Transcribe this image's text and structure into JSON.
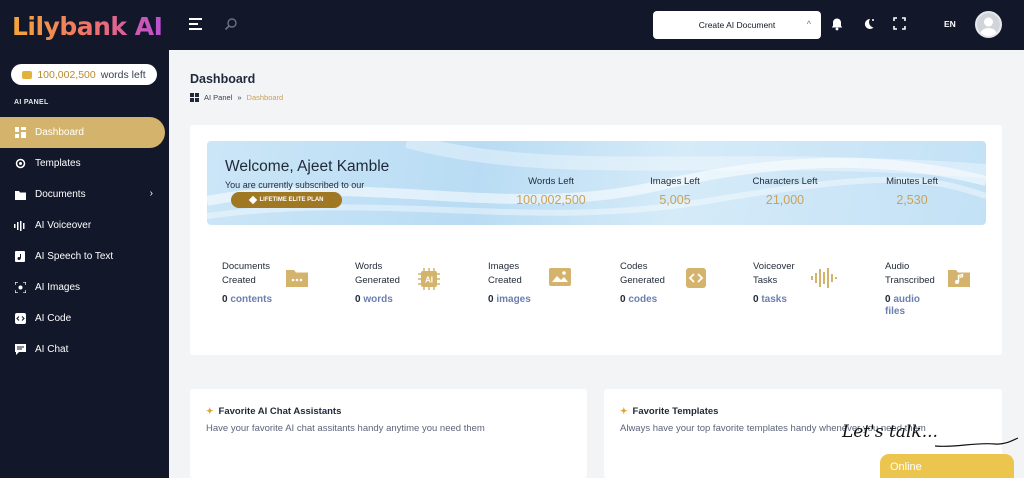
{
  "app": {
    "logo_text": "Lilybank AI",
    "words_left_value": "100,002,500",
    "words_left_label": "words left",
    "panel_label": "AI PANEL"
  },
  "sidebar": {
    "items": [
      {
        "label": "Dashboard",
        "icon": "dashboard-icon",
        "active": true
      },
      {
        "label": "Templates",
        "icon": "templates-icon"
      },
      {
        "label": "Documents",
        "icon": "folder-icon",
        "has_submenu": true
      },
      {
        "label": "AI Voiceover",
        "icon": "waveform-icon"
      },
      {
        "label": "AI Speech to Text",
        "icon": "audio-file-icon"
      },
      {
        "label": "AI Images",
        "icon": "image-scan-icon"
      },
      {
        "label": "AI Code",
        "icon": "code-icon"
      },
      {
        "label": "AI Chat",
        "icon": "chat-icon"
      }
    ]
  },
  "topbar": {
    "create_button": "Create AI Document",
    "language": "EN"
  },
  "header": {
    "title": "Dashboard",
    "breadcrumb": [
      "AI Panel",
      "»",
      "Dashboard"
    ]
  },
  "welcome": {
    "title": "Welcome, Ajeet Kamble",
    "subtitle": "You are currently subscribed to our",
    "plan": "LIFETIME ELITE PLAN",
    "stats": [
      {
        "label": "Words Left",
        "value": "100,002,500"
      },
      {
        "label": "Images Left",
        "value": "5,005"
      },
      {
        "label": "Characters Left",
        "value": "21,000"
      },
      {
        "label": "Minutes Left",
        "value": "2,530"
      }
    ]
  },
  "metrics": [
    {
      "line1": "Documents",
      "line2": "Created",
      "count": "0",
      "unit": "contents",
      "icon": "folder-dots-icon"
    },
    {
      "line1": "Words",
      "line2": "Generated",
      "count": "0",
      "unit": "words",
      "icon": "ai-chip-icon"
    },
    {
      "line1": "Images",
      "line2": "Created",
      "count": "0",
      "unit": "images",
      "icon": "image-icon"
    },
    {
      "line1": "Codes",
      "line2": "Generated",
      "count": "0",
      "unit": "codes",
      "icon": "code-icon"
    },
    {
      "line1": "Voiceover",
      "line2": "Tasks",
      "count": "0",
      "unit": "tasks",
      "icon": "waveform-icon"
    },
    {
      "line1": "Audio",
      "line2": "Transcribed",
      "count": "0",
      "unit": "audio files",
      "icon": "music-folder-icon"
    }
  ],
  "cards": [
    {
      "title": "Favorite AI Chat Assistants",
      "subtitle": "Have your favorite AI chat assitants handy anytime you need them"
    },
    {
      "title": "Favorite Templates",
      "subtitle": "Always have your top favorite templates handy whenever you need them"
    }
  ],
  "chat_widget": {
    "script_text": "Let's talk...",
    "status": "Online"
  },
  "colors": {
    "sidebar_bg": "#13172a",
    "accent_gold": "#d4b46d",
    "value_gold": "#c9a25a",
    "badge_brown": "#a07722",
    "chat_yellow": "#ecc54e"
  }
}
